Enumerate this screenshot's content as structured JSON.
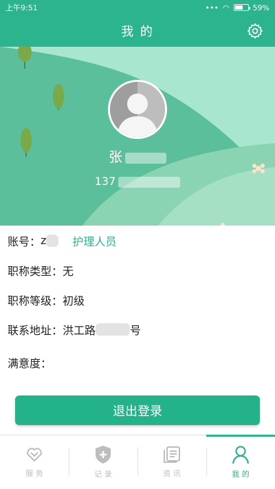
{
  "status_bar": {
    "time": "上午9:51",
    "battery_percent": "59%",
    "battery_level": 0.59
  },
  "app_bar": {
    "title": "我 的",
    "settings_icon": "gear-icon"
  },
  "profile": {
    "name": "张",
    "phone": "137"
  },
  "info": {
    "account_label": "账号：",
    "account_value": "z",
    "role": "护理人员",
    "title_type_label": "职称类型：",
    "title_type_value": "无",
    "title_level_label": "职称等级：",
    "title_level_value": "初级",
    "address_label": "联系地址：",
    "address_value": "洪工路",
    "address_suffix": "号",
    "satisfaction_label": "满意度："
  },
  "logout_label": "退出登录",
  "bottom_nav": {
    "items": [
      {
        "label": "服 务",
        "icon": "service-icon"
      },
      {
        "label": "记 录",
        "icon": "record-icon"
      },
      {
        "label": "资 讯",
        "icon": "news-icon"
      },
      {
        "label": "我 的",
        "icon": "profile-icon"
      }
    ],
    "active_index": 3
  },
  "colors": {
    "primary": "#2bb48d",
    "inactive": "#bdbdbd"
  }
}
